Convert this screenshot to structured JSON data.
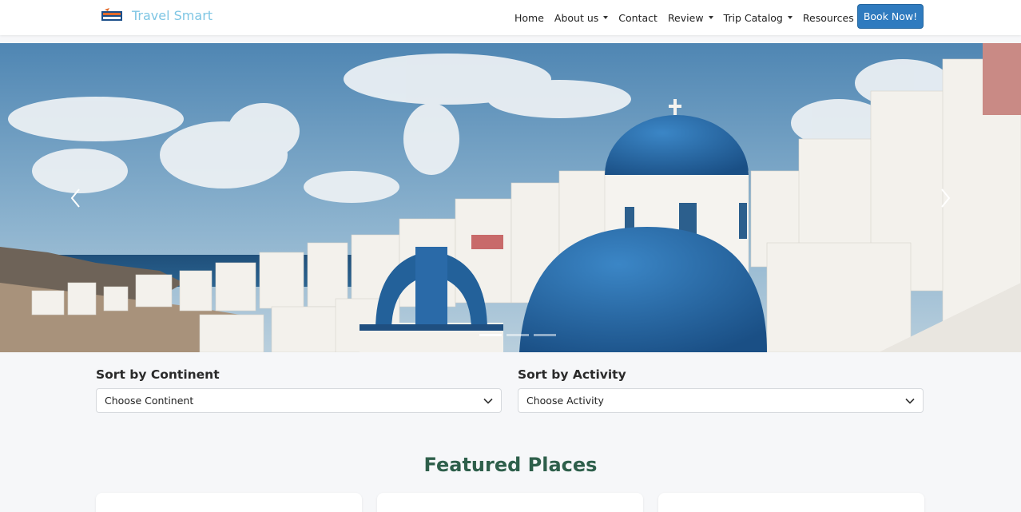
{
  "brand": {
    "name": "Travel Smart",
    "logo_icon": "travel-smart-logo"
  },
  "nav": {
    "items": [
      {
        "label": "Home",
        "dropdown": false
      },
      {
        "label": "About us",
        "dropdown": true
      },
      {
        "label": "Contact",
        "dropdown": false
      },
      {
        "label": "Review",
        "dropdown": true
      },
      {
        "label": "Trip Catalog",
        "dropdown": true
      },
      {
        "label": "Resources",
        "dropdown": true
      }
    ],
    "book_label": "Book Now!"
  },
  "hero": {
    "prev_icon": "chevron-left-icon",
    "next_icon": "chevron-right-icon",
    "slide_count": 3,
    "active_slide": 1
  },
  "filters": {
    "continent": {
      "label": "Sort by Continent",
      "value": "Choose Continent"
    },
    "activity": {
      "label": "Sort by Activity",
      "value": "Choose Activity"
    }
  },
  "featured": {
    "title": "Featured Places"
  },
  "colors": {
    "brand": "#7fc6e4",
    "primary": "#2f7bbf",
    "heading": "#2e5f4b",
    "dome": "#2a6aa8"
  }
}
